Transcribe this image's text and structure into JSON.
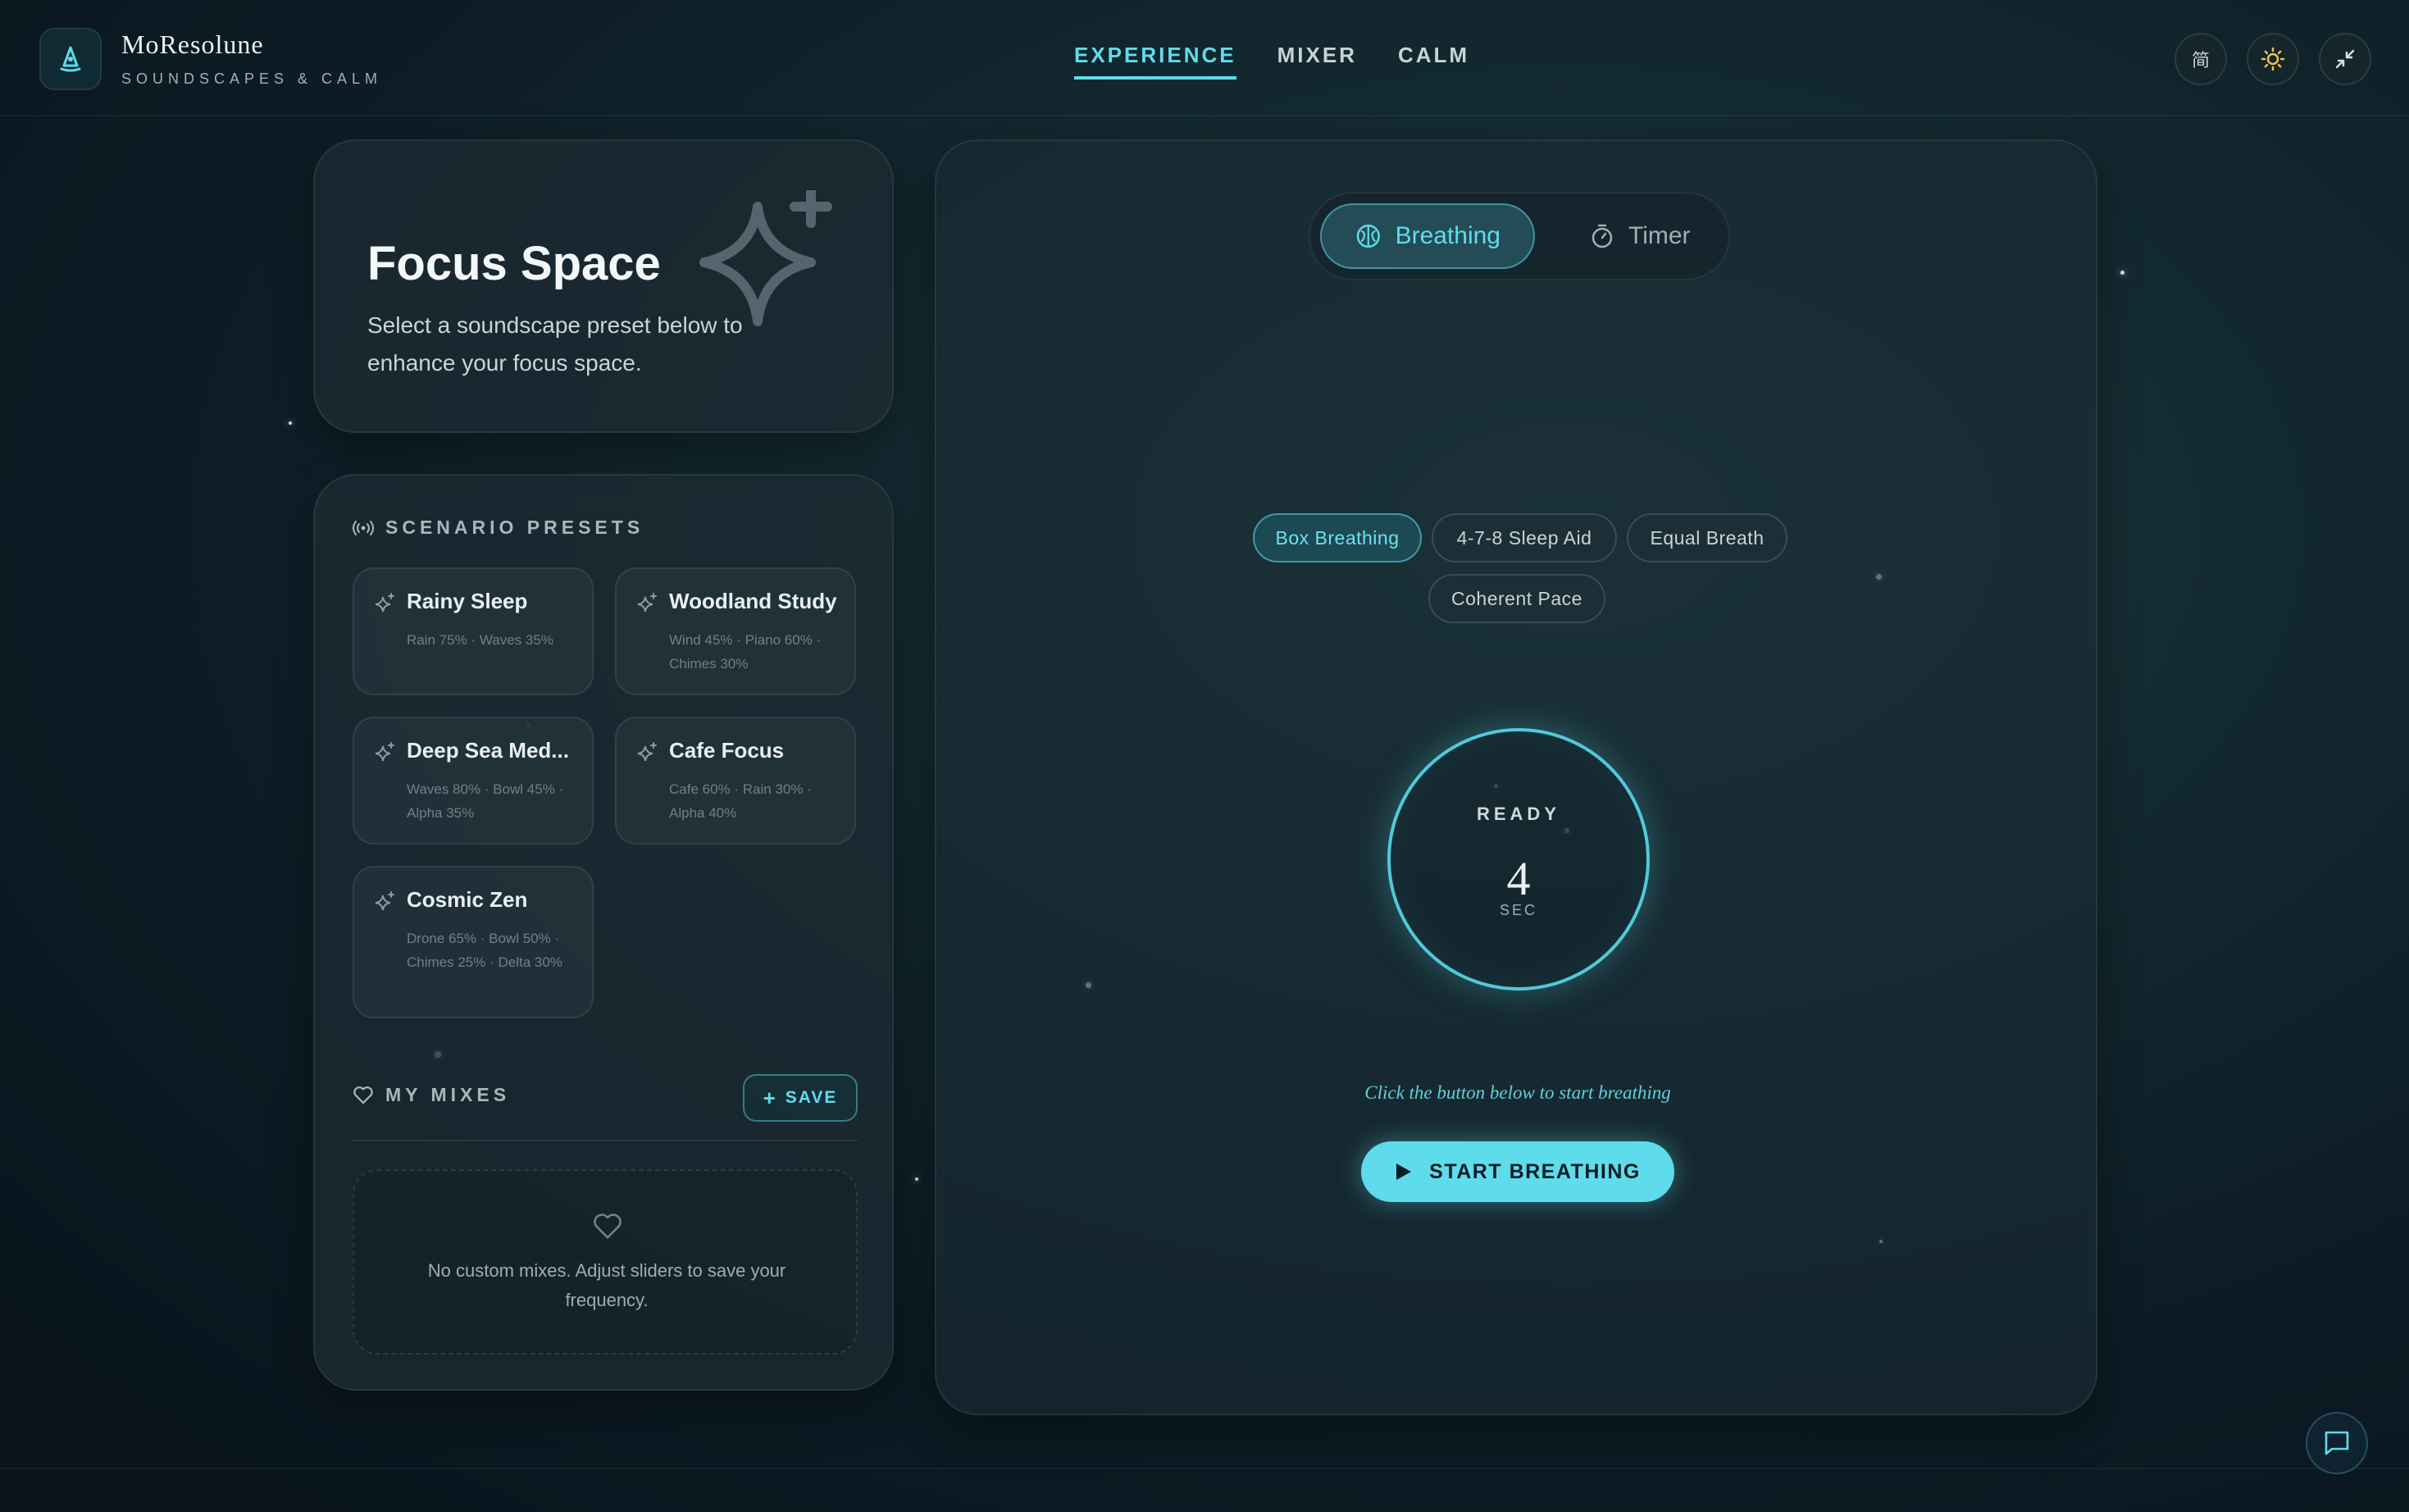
{
  "header": {
    "brand_name": "MoResolune",
    "brand_subtitle": "SOUNDSCAPES & CALM",
    "nav": [
      {
        "label": "EXPERIENCE",
        "active": true
      },
      {
        "label": "MIXER",
        "active": false
      },
      {
        "label": "CALM",
        "active": false
      }
    ],
    "lang_label": "简",
    "icons": [
      "language-icon",
      "sun-icon",
      "minimize-icon"
    ]
  },
  "focus": {
    "title": "Focus Space",
    "description": "Select a soundscape preset below to enhance your focus space."
  },
  "presets": {
    "section_label": "SCENARIO PRESETS",
    "items": [
      {
        "name": "Rainy Sleep",
        "detail": "Rain 75% · Waves 35%"
      },
      {
        "name": "Woodland Study",
        "detail": "Wind 45% · Piano 60% · Chimes 30%"
      },
      {
        "name": "Deep Sea Med...",
        "detail": "Waves 80% · Bowl 45% · Alpha 35%"
      },
      {
        "name": "Cafe Focus",
        "detail": "Cafe 60% · Rain 30% · Alpha 40%"
      },
      {
        "name": "Cosmic Zen",
        "detail": "Drone 65% · Bowl 50% · Chimes 25% · Delta 30%"
      }
    ]
  },
  "mixes": {
    "section_label": "MY MIXES",
    "save_label": "SAVE",
    "empty_text": "No custom mixes. Adjust sliders to save your frequency."
  },
  "main": {
    "modes": [
      {
        "label": "Breathing",
        "active": true
      },
      {
        "label": "Timer",
        "active": false
      }
    ],
    "patterns": [
      {
        "label": "Box Breathing",
        "active": true
      },
      {
        "label": "4-7-8 Sleep Aid",
        "active": false
      },
      {
        "label": "Equal Breath",
        "active": false
      },
      {
        "label": "Coherent Pace",
        "active": false
      }
    ],
    "ring": {
      "state": "READY",
      "value": "4",
      "unit": "SEC"
    },
    "hint": "Click the button below to start breathing",
    "start_label": "START BREATHING"
  },
  "colors": {
    "accent": "#5fdcec",
    "sun": "#f2c14e",
    "background": "#0c1b24"
  }
}
